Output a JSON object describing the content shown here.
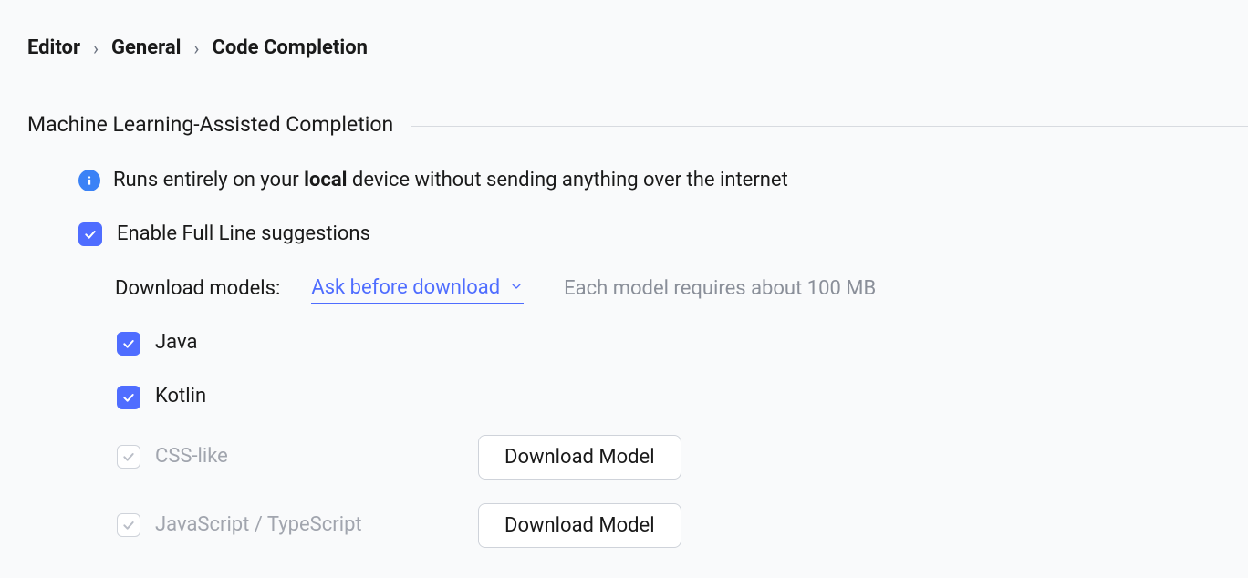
{
  "breadcrumb": {
    "level1": "Editor",
    "level2": "General",
    "level3": "Code Completion"
  },
  "section": {
    "title": "Machine Learning-Assisted Completion"
  },
  "info": {
    "text_before": "Runs entirely on your ",
    "text_bold": "local",
    "text_after": " device without sending anything over the internet"
  },
  "enable": {
    "label": "Enable Full Line suggestions"
  },
  "download": {
    "label": "Download models:",
    "dropdown_value": "Ask before download",
    "hint": "Each model requires about 100 MB"
  },
  "languages": [
    {
      "name": "Java",
      "checked": true,
      "disabled": false,
      "needs_download": false
    },
    {
      "name": "Kotlin",
      "checked": true,
      "disabled": false,
      "needs_download": false
    },
    {
      "name": "CSS-like",
      "checked": true,
      "disabled": true,
      "needs_download": true
    },
    {
      "name": "JavaScript / TypeScript",
      "checked": true,
      "disabled": true,
      "needs_download": true
    }
  ],
  "buttons": {
    "download_model": "Download Model"
  }
}
